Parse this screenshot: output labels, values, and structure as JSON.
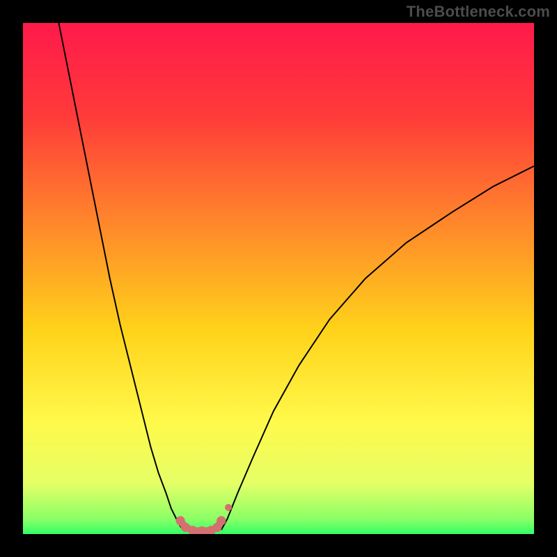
{
  "attribution": "TheBottleneck.com",
  "chart_data": {
    "type": "line",
    "title": "",
    "xlabel": "",
    "ylabel": "",
    "xlim": [
      0,
      100
    ],
    "ylim": [
      0,
      100
    ],
    "gradient_stops": [
      {
        "pct": 0,
        "color": "#ff1a4b"
      },
      {
        "pct": 18,
        "color": "#ff3a3a"
      },
      {
        "pct": 40,
        "color": "#ff8a2a"
      },
      {
        "pct": 60,
        "color": "#ffd21a"
      },
      {
        "pct": 78,
        "color": "#fff94a"
      },
      {
        "pct": 90,
        "color": "#e6ff66"
      },
      {
        "pct": 97,
        "color": "#8cff66"
      },
      {
        "pct": 100,
        "color": "#33ff66"
      }
    ],
    "series": [
      {
        "name": "left-curve",
        "color": "#000000",
        "width": 2,
        "x": [
          7,
          9,
          11,
          13,
          15,
          17,
          19,
          21,
          23,
          25,
          26.5,
          28,
          29,
          30,
          30.8,
          31.4
        ],
        "y": [
          100,
          90,
          80,
          70,
          60,
          50,
          41,
          33,
          25,
          17,
          12,
          8,
          5,
          3,
          1.5,
          0.8
        ]
      },
      {
        "name": "right-curve",
        "color": "#000000",
        "width": 2,
        "x": [
          38.8,
          40,
          42,
          45,
          49,
          54,
          60,
          67,
          75,
          84,
          92,
          100
        ],
        "y": [
          0.8,
          3,
          8,
          15,
          24,
          33,
          42,
          50,
          57,
          63,
          68,
          72
        ]
      },
      {
        "name": "trough-highlight",
        "color": "#d4706f",
        "width": 10,
        "linecap": "round",
        "points_marker": true,
        "x": [
          30.8,
          31.8,
          33.2,
          35.0,
          36.8,
          38.0,
          38.8
        ],
        "y": [
          2.6,
          1.3,
          0.7,
          0.6,
          0.7,
          1.3,
          2.6
        ]
      },
      {
        "name": "right-start-dot",
        "color": "#d4706f",
        "marker_only": true,
        "radius": 5,
        "x": [
          40.2
        ],
        "y": [
          5.2
        ]
      }
    ]
  }
}
